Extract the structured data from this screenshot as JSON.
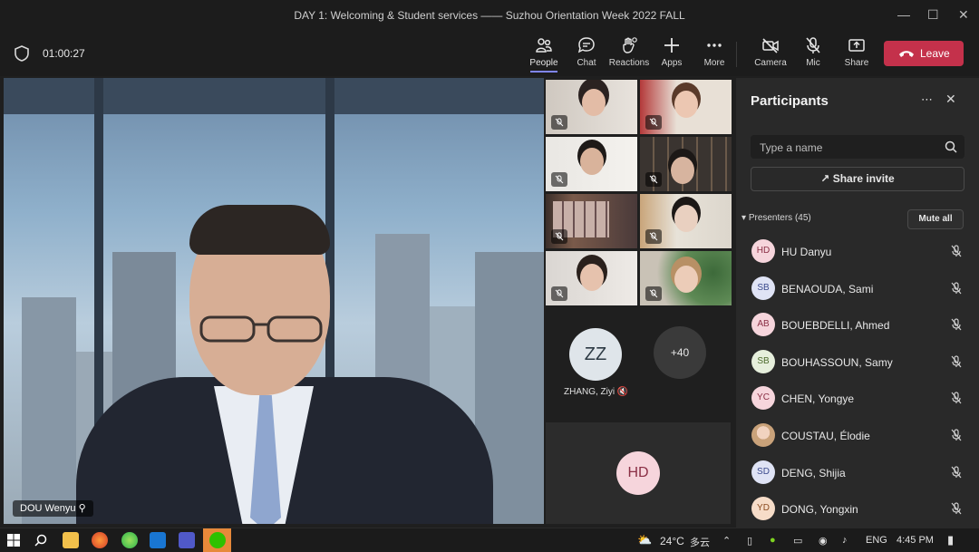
{
  "window": {
    "title": "DAY 1: Welcoming & Student services —— Suzhou Orientation Week 2022 FALL"
  },
  "meeting": {
    "timer": "01:00:27",
    "toolbar": [
      {
        "label": "People",
        "icon": "people-icon",
        "active": true
      },
      {
        "label": "Chat",
        "icon": "chat-icon"
      },
      {
        "label": "Reactions",
        "icon": "reactions-icon"
      },
      {
        "label": "Apps",
        "icon": "apps-icon"
      },
      {
        "label": "More",
        "icon": "more-icon"
      },
      {
        "label": "Camera",
        "icon": "camera-off-icon"
      },
      {
        "label": "Mic",
        "icon": "mic-off-icon"
      },
      {
        "label": "Share",
        "icon": "share-icon"
      }
    ],
    "leave_label": "Leave",
    "accent": "#7f85f5",
    "leave_color": "#c4314b"
  },
  "stage": {
    "speaker_name": "DOU Wenyu"
  },
  "gallery": {
    "zz_initials": "ZZ",
    "zz_name": "ZHANG, Ziyi",
    "more_count": "+40",
    "hd_initials": "HD"
  },
  "participants": {
    "title": "Participants",
    "search_placeholder": "Type a name",
    "share_invite": "Share invite",
    "presenters_label": "Presenters (45)",
    "mute_all": "Mute all",
    "list": [
      {
        "initials": "HD",
        "name": "HU Danyu",
        "color": "#f6d5dc",
        "text_color": "#8a2f45"
      },
      {
        "initials": "SB",
        "name": "BENAOUDA, Sami",
        "color": "#dfe3f5",
        "text_color": "#3b4a8c"
      },
      {
        "initials": "AB",
        "name": "BOUEBDELLI, Ahmed",
        "color": "#f6d5dc",
        "text_color": "#8a2f45"
      },
      {
        "initials": "SB",
        "name": "BOUHASSOUN, Samy",
        "color": "#e6efdc",
        "text_color": "#4c6a2c"
      },
      {
        "initials": "YC",
        "name": "CHEN, Yongye",
        "color": "#f6d5dc",
        "text_color": "#8a2f45"
      },
      {
        "initials": "",
        "name": "COUSTAU, Élodie",
        "color": "#c9a27a",
        "text_color": "#3a2a1a"
      },
      {
        "initials": "SD",
        "name": "DENG, Shijia",
        "color": "#dfe3f5",
        "text_color": "#3b4a8c"
      },
      {
        "initials": "YD",
        "name": "DONG, Yongxin",
        "color": "#f6dcc8",
        "text_color": "#8a4a20"
      }
    ]
  },
  "taskbar": {
    "weather": "24°C",
    "weather_desc": "多云",
    "lang": "ENG",
    "time": "4:45 PM"
  }
}
